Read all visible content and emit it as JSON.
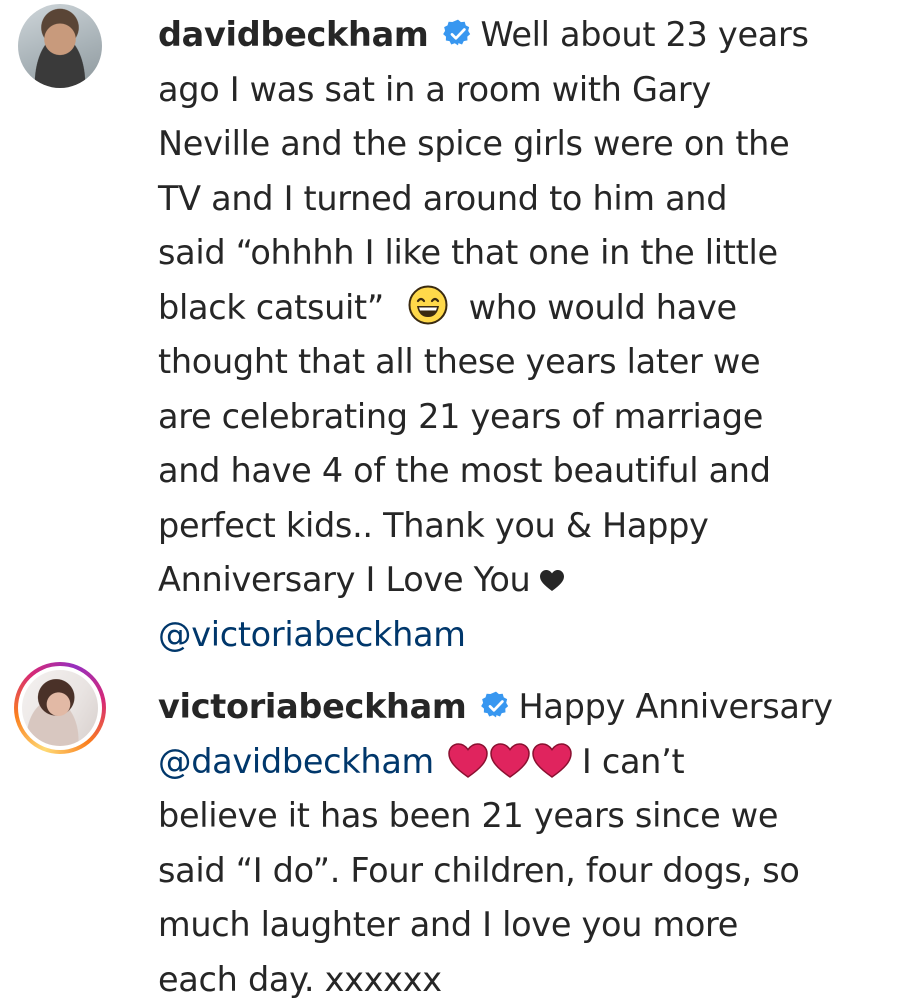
{
  "comments": [
    {
      "username": "davidbeckham",
      "verified": true,
      "lines": [
        "Well about 23 years",
        "ago I was sat in a room with Gary",
        "Neville and the spice girls were on the",
        "TV and I turned around to him and",
        "said “ohhhh I like that one in the little",
        "black catsuit”",
        "who would have",
        "thought that all these years later we",
        "are celebrating 21 years of marriage",
        "and have 4 of the most beautiful and",
        "perfect kids.. Thank you & Happy",
        "Anniversary I Love You",
        "@victoriabeckham"
      ],
      "emoji": "grinning-face-icon"
    },
    {
      "username": "victoriabeckham",
      "verified": true,
      "lines": [
        "Happy Anniversary",
        "@davidbeckham",
        "I can’t",
        "believe it has been 21 years since we",
        "said “I do”. Four children, four dogs, so",
        "much laughter and I love you more",
        "each day. xxxxxx"
      ]
    }
  ],
  "colors": {
    "text": "#262626",
    "mention": "#00376b",
    "verified": "#3897f0",
    "heart_red": "#e0245e"
  }
}
